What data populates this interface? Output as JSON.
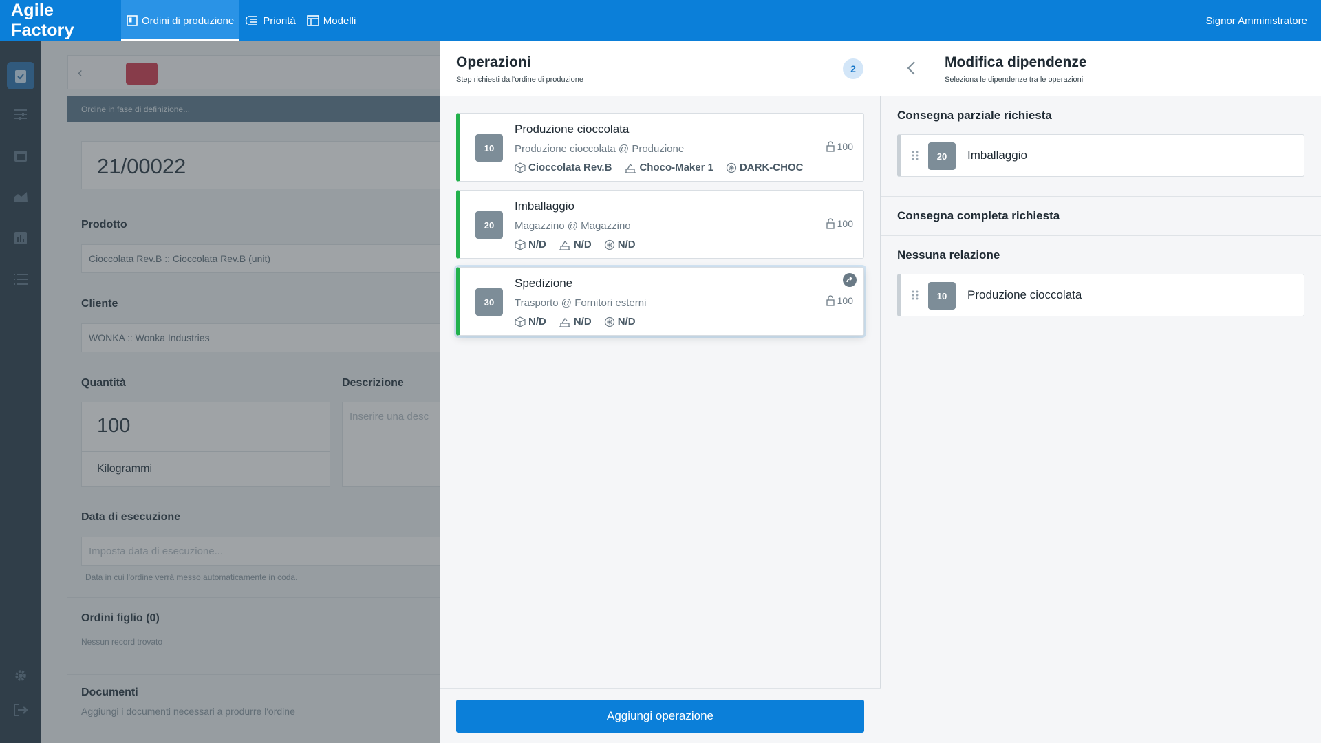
{
  "app": {
    "title": "Agile Factory",
    "user": "Signor Amministratore"
  },
  "nav": [
    {
      "label": "Ordini di produzione",
      "icon": "board-icon",
      "active": true
    },
    {
      "label": "Priorità",
      "icon": "priority-list-icon",
      "active": false
    },
    {
      "label": "Modelli",
      "icon": "template-icon",
      "active": false
    }
  ],
  "sidebar": {
    "items": [
      {
        "icon": "clipboard-check-icon",
        "active": true
      },
      {
        "icon": "sliders-icon"
      },
      {
        "icon": "calendar-icon"
      },
      {
        "icon": "area-chart-icon"
      },
      {
        "icon": "bar-chart-icon"
      },
      {
        "icon": "list-icon"
      },
      {
        "icon": "gear-icon"
      },
      {
        "icon": "logout-icon"
      }
    ]
  },
  "form": {
    "status": "Ordine in fase di definizione...",
    "code": "21/00022",
    "product_label": "Prodotto",
    "product_value": "Cioccolata Rev.B :: Cioccolata Rev.B (unit)",
    "customer_label": "Cliente",
    "customer_value": "WONKA :: Wonka Industries",
    "quantity_label": "Quantità",
    "quantity_value": "100",
    "unit_value": "Kilogrammi",
    "description_label": "Descrizione",
    "description_placeholder": "Inserire una desc",
    "exec_date_label": "Data di esecuzione",
    "exec_date_placeholder": "Imposta data di esecuzione...",
    "exec_date_help": "Data in cui l'ordine verrà messo automaticamente in coda.",
    "children_label": "Ordini figlio (0)",
    "children_empty": "Nessun record trovato",
    "documents_label": "Documenti",
    "documents_help": "Aggiungi i documenti necessari a produrre l'ordine"
  },
  "operations": {
    "title": "Operazioni",
    "subtitle": "Step richiesti dall'ordine di produzione",
    "count": "2",
    "items": [
      {
        "seq": "10",
        "title": "Produzione cioccolata",
        "subtitle": "Produzione cioccolata @ Produzione",
        "qty": "100",
        "product": "Cioccolata Rev.B",
        "machine": "Choco-Maker 1",
        "material": "DARK-CHOC",
        "selected": false
      },
      {
        "seq": "20",
        "title": "Imballaggio",
        "subtitle": "Magazzino @ Magazzino",
        "qty": "100",
        "product": "N/D",
        "machine": "N/D",
        "material": "N/D",
        "selected": false
      },
      {
        "seq": "30",
        "title": "Spedizione",
        "subtitle": "Trasporto @ Fornitori esterni",
        "qty": "100",
        "product": "N/D",
        "machine": "N/D",
        "material": "N/D",
        "selected": true
      }
    ],
    "add_label": "Aggiungi operazione"
  },
  "dependencies": {
    "title": "Modifica dipendenze",
    "subtitle": "Seleziona le dipendenze tra le operazioni",
    "partial": {
      "label": "Consegna parziale richiesta",
      "items": [
        {
          "seq": "20",
          "title": "Imballaggio"
        }
      ]
    },
    "complete": {
      "label": "Consegna completa richiesta",
      "items": []
    },
    "none": {
      "label": "Nessuna relazione",
      "items": [
        {
          "seq": "10",
          "title": "Produzione cioccolata"
        }
      ]
    }
  }
}
